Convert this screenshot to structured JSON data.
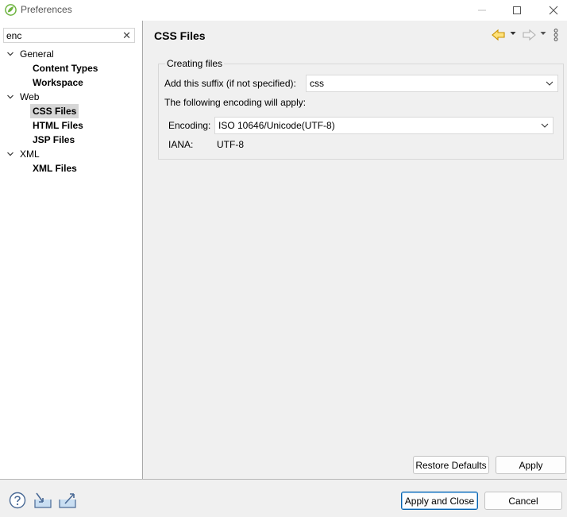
{
  "window": {
    "title": "Preferences",
    "icon": "spring-leaf-icon"
  },
  "filter": {
    "value": "enc"
  },
  "tree": [
    {
      "label": "General",
      "expanded": true,
      "children": [
        "Content Types",
        "Workspace"
      ]
    },
    {
      "label": "Web",
      "expanded": true,
      "children": [
        "CSS Files",
        "HTML Files",
        "JSP Files"
      ]
    },
    {
      "label": "XML",
      "expanded": true,
      "children": [
        "XML Files"
      ]
    }
  ],
  "selected_item": "CSS Files",
  "page": {
    "title": "CSS Files",
    "group_title": "Creating files",
    "suffix_label": "Add this suffix (if not specified):",
    "suffix_value": "css",
    "encoding_note": "The following encoding will apply:",
    "encoding_label": "Encoding:",
    "encoding_value": "ISO 10646/Unicode(UTF-8)",
    "iana_label": "IANA:",
    "iana_value": "UTF-8"
  },
  "buttons": {
    "restore_defaults": "Restore Defaults",
    "apply": "Apply",
    "apply_and_close": "Apply and Close",
    "cancel": "Cancel"
  },
  "colors": {
    "accent": "#0a64ad",
    "nav_arrow": "#e8a800",
    "selection": "#d6d6d6"
  }
}
